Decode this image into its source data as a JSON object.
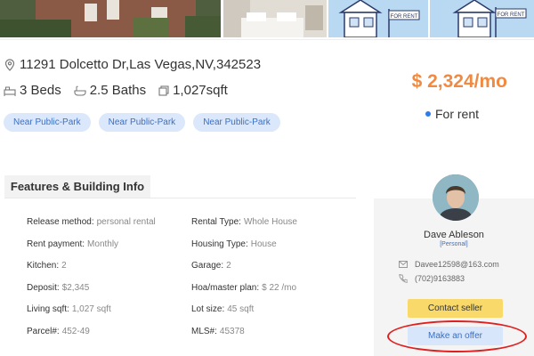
{
  "gallery": {
    "sign_labels": [
      "FOR RENT",
      "FOR RENT"
    ]
  },
  "listing": {
    "address": "11291 Dolcetto Dr,Las Vegas,NV,342523",
    "beds": "3 Beds",
    "baths": "2.5 Baths",
    "area": "1,027sqft",
    "tags": [
      "Near Public-Park",
      "Near Public-Park",
      "Near Public-Park"
    ],
    "price": "$ 2,324/mo",
    "status": "For rent",
    "status_color": "#2b7de9",
    "price_color": "#f08a42"
  },
  "features": {
    "title": "Features & Building Info",
    "rows": [
      {
        "left": {
          "label": "Release method:",
          "value": "personal rental"
        },
        "right": {
          "label": "Rental Type:",
          "value": "Whole House"
        }
      },
      {
        "left": {
          "label": "Rent payment:",
          "value": "Monthly"
        },
        "right": {
          "label": "Housing Type:",
          "value": "House"
        }
      },
      {
        "left": {
          "label": "Kitchen:",
          "value": "2"
        },
        "right": {
          "label": "Garage:",
          "value": "2"
        }
      },
      {
        "left": {
          "label": "Deposit:",
          "value": "$2,345"
        },
        "right": {
          "label": "Hoa/master plan:",
          "value": "$ 22 /mo"
        }
      },
      {
        "left": {
          "label": "Living sqft:",
          "value": "1,027 sqft"
        },
        "right": {
          "label": "Lot size:",
          "value": "45 sqft"
        }
      },
      {
        "left": {
          "label": "Parcel#:",
          "value": "452-49"
        },
        "right": {
          "label": "MLS#:",
          "value": "45378"
        }
      }
    ]
  },
  "seller": {
    "name": "Dave Ableson",
    "badge": "[Personal]",
    "email": "Davee12598@163.com",
    "phone": "(702)9163883",
    "contact_label": "Contact seller",
    "offer_label": "Make an offer",
    "highlight_color": "#e02020"
  }
}
